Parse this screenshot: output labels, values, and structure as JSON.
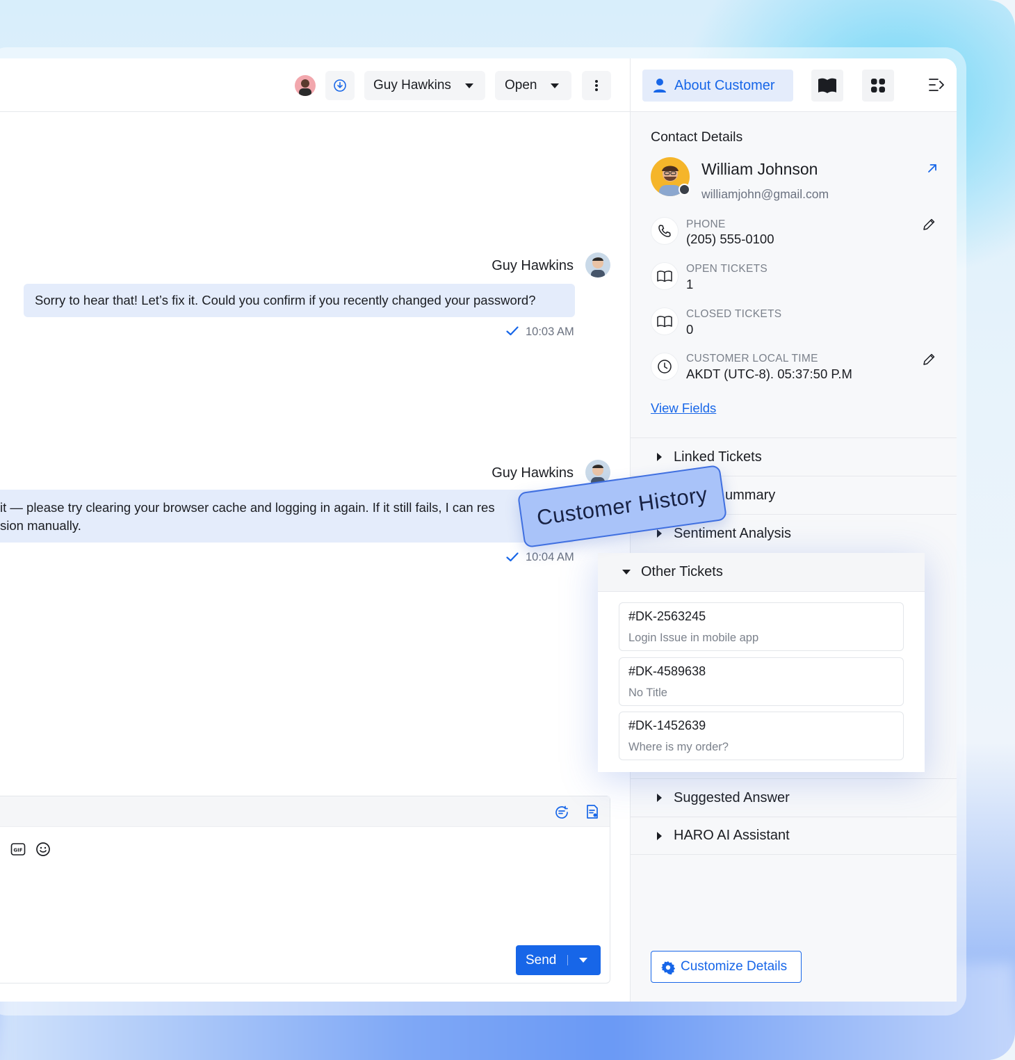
{
  "chat": {
    "header": {
      "agent_name": "Guy Hawkins",
      "status": "Open"
    },
    "messages": [
      {
        "sender": "Guy Hawkins",
        "text": "Sorry to hear that! Let’s fix it. Could you confirm if you recently changed your password?",
        "time": "10:03 AM"
      },
      {
        "sender": "Guy Hawkins",
        "line1": "it — please try clearing your browser cache and logging in again. If it still fails, I can res",
        "line2": "sion manually.",
        "time": "10:04 AM"
      }
    ],
    "composer": {
      "send_label": "Send"
    }
  },
  "sidebar": {
    "tab_about": "About Customer",
    "contact_section": "Contact Details",
    "contact": {
      "name": "William Johnson",
      "email": "williamjohn@gmail.com"
    },
    "fields": [
      {
        "label": "PHONE",
        "value": "(205) 555-0100"
      },
      {
        "label": "OPEN TICKETS",
        "value": "1"
      },
      {
        "label": "CLOSED TICKETS",
        "value": "0"
      },
      {
        "label": "CUSTOMER LOCAL TIME",
        "value": "AKDT (UTC-8). 05:37:50 P.M"
      }
    ],
    "view_fields": "View Fields",
    "accordions": {
      "linked_tickets": "Linked Tickets",
      "summary": "ummary",
      "sentiment": "Sentiment Analysis",
      "suggested_answer": "Suggested Answer",
      "haro_ai": "HARO AI Assistant"
    },
    "customize": "Customize Details"
  },
  "other_tickets": {
    "title": "Other Tickets",
    "items": [
      {
        "id": "#DK-2563245",
        "title": "Login Issue in mobile app"
      },
      {
        "id": "#DK-4589638",
        "title": "No Title"
      },
      {
        "id": "#DK-1452639",
        "title": "Where is my order?"
      }
    ]
  },
  "tag": "Customer History",
  "colors": {
    "accent": "#1766e8",
    "bubble": "#e4ecfb",
    "tag_bg": "#a9c3f9"
  }
}
